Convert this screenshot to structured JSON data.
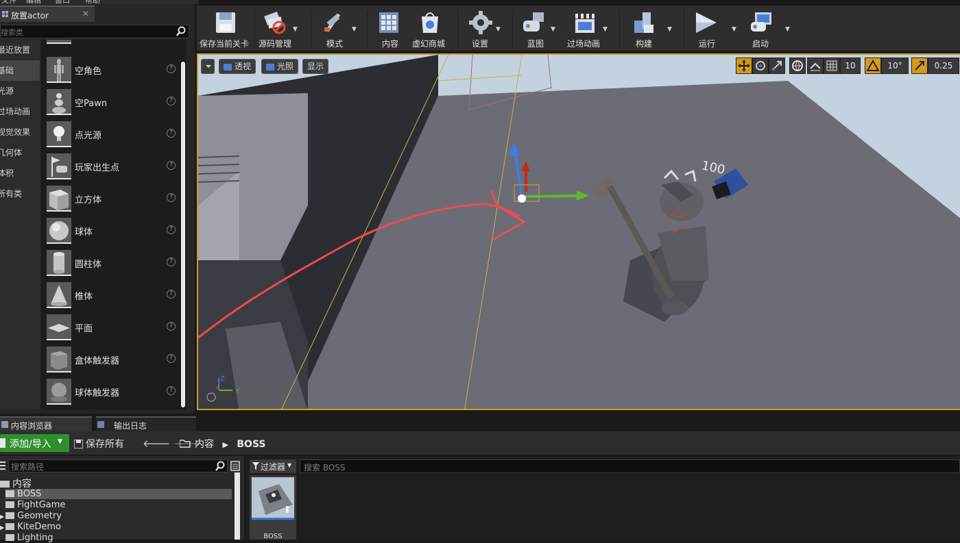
{
  "menubar": {
    "items": [
      "文件",
      "编辑",
      "窗口",
      "帮助"
    ]
  },
  "place_panel": {
    "tab_title": "放置actor",
    "search_placeholder": "搜索类",
    "categories": [
      {
        "label": "最近放置",
        "selected": false
      },
      {
        "label": "基础",
        "selected": true
      },
      {
        "label": "光源",
        "selected": false
      },
      {
        "label": "过场动画",
        "selected": false
      },
      {
        "label": "视觉效果",
        "selected": false
      },
      {
        "label": "几何体",
        "selected": false
      },
      {
        "label": "体积",
        "selected": false
      },
      {
        "label": "所有类",
        "selected": false
      }
    ],
    "items": [
      {
        "label": "空角色",
        "icon": "empty-character-icon"
      },
      {
        "label": "空Pawn",
        "icon": "pawn-icon"
      },
      {
        "label": "点光源",
        "icon": "point-light-icon"
      },
      {
        "label": "玩家出生点",
        "icon": "player-start-icon"
      },
      {
        "label": "立方体",
        "icon": "cube-icon"
      },
      {
        "label": "球体",
        "icon": "sphere-icon"
      },
      {
        "label": "圆柱体",
        "icon": "cylinder-icon"
      },
      {
        "label": "椎体",
        "icon": "cone-icon"
      },
      {
        "label": "平面",
        "icon": "plane-icon"
      },
      {
        "label": "盒体触发器",
        "icon": "box-trigger-icon"
      },
      {
        "label": "球体触发器",
        "icon": "sphere-trigger-icon"
      }
    ],
    "help_glyph": "?"
  },
  "toolbar": {
    "buttons": [
      {
        "label": "保存当前关卡",
        "icon": "save-icon",
        "dropdown": false
      },
      {
        "label": "源码管理",
        "icon": "source-control-icon",
        "dropdown": true
      },
      {
        "label": "模式",
        "icon": "modes-icon",
        "dropdown": true
      },
      {
        "label": "内容",
        "icon": "content-icon",
        "dropdown": false
      },
      {
        "label": "虚幻商城",
        "icon": "marketplace-icon",
        "dropdown": false
      },
      {
        "label": "设置",
        "icon": "settings-icon",
        "dropdown": true
      },
      {
        "label": "蓝图",
        "icon": "blueprint-icon",
        "dropdown": true
      },
      {
        "label": "过场动画",
        "icon": "cinematics-icon",
        "dropdown": true
      },
      {
        "label": "构建",
        "icon": "build-icon",
        "dropdown": true
      },
      {
        "label": "运行",
        "icon": "play-icon",
        "dropdown": true
      },
      {
        "label": "启动",
        "icon": "launch-icon",
        "dropdown": true
      }
    ]
  },
  "viewport": {
    "view_mode": "透视",
    "lit_mode": "光照",
    "show": "显示",
    "grid_snap": "10",
    "rotation_snap": "10°",
    "scale_snap": "0.25",
    "axis_z": "Z",
    "axis_y": "Y",
    "annotation_text": "100"
  },
  "bottom": {
    "tabs": [
      {
        "label": "内容浏览器"
      },
      {
        "label": "输出日志"
      }
    ],
    "add_import": "添加/导入",
    "save_all": "保存所有",
    "breadcrumb": [
      "内容",
      "BOSS"
    ],
    "path_search_placeholder": "搜索路径",
    "tree_root": "内容",
    "tree": [
      {
        "label": "BOSS",
        "selected": true,
        "expandable": false
      },
      {
        "label": "FightGame",
        "selected": false,
        "expandable": false
      },
      {
        "label": "Geometry",
        "selected": false,
        "expandable": true
      },
      {
        "label": "KiteDemo",
        "selected": false,
        "expandable": true
      },
      {
        "label": "Lighting",
        "selected": false,
        "expandable": false
      }
    ],
    "filters_label": "过滤器",
    "asset_search_placeholder": "搜索 BOSS",
    "asset": {
      "name": "BOSS"
    }
  },
  "colors": {
    "accent_orange": "#d39b1c",
    "add_green": "#2f8f2f",
    "annotation_red": "#ef4a4a"
  }
}
